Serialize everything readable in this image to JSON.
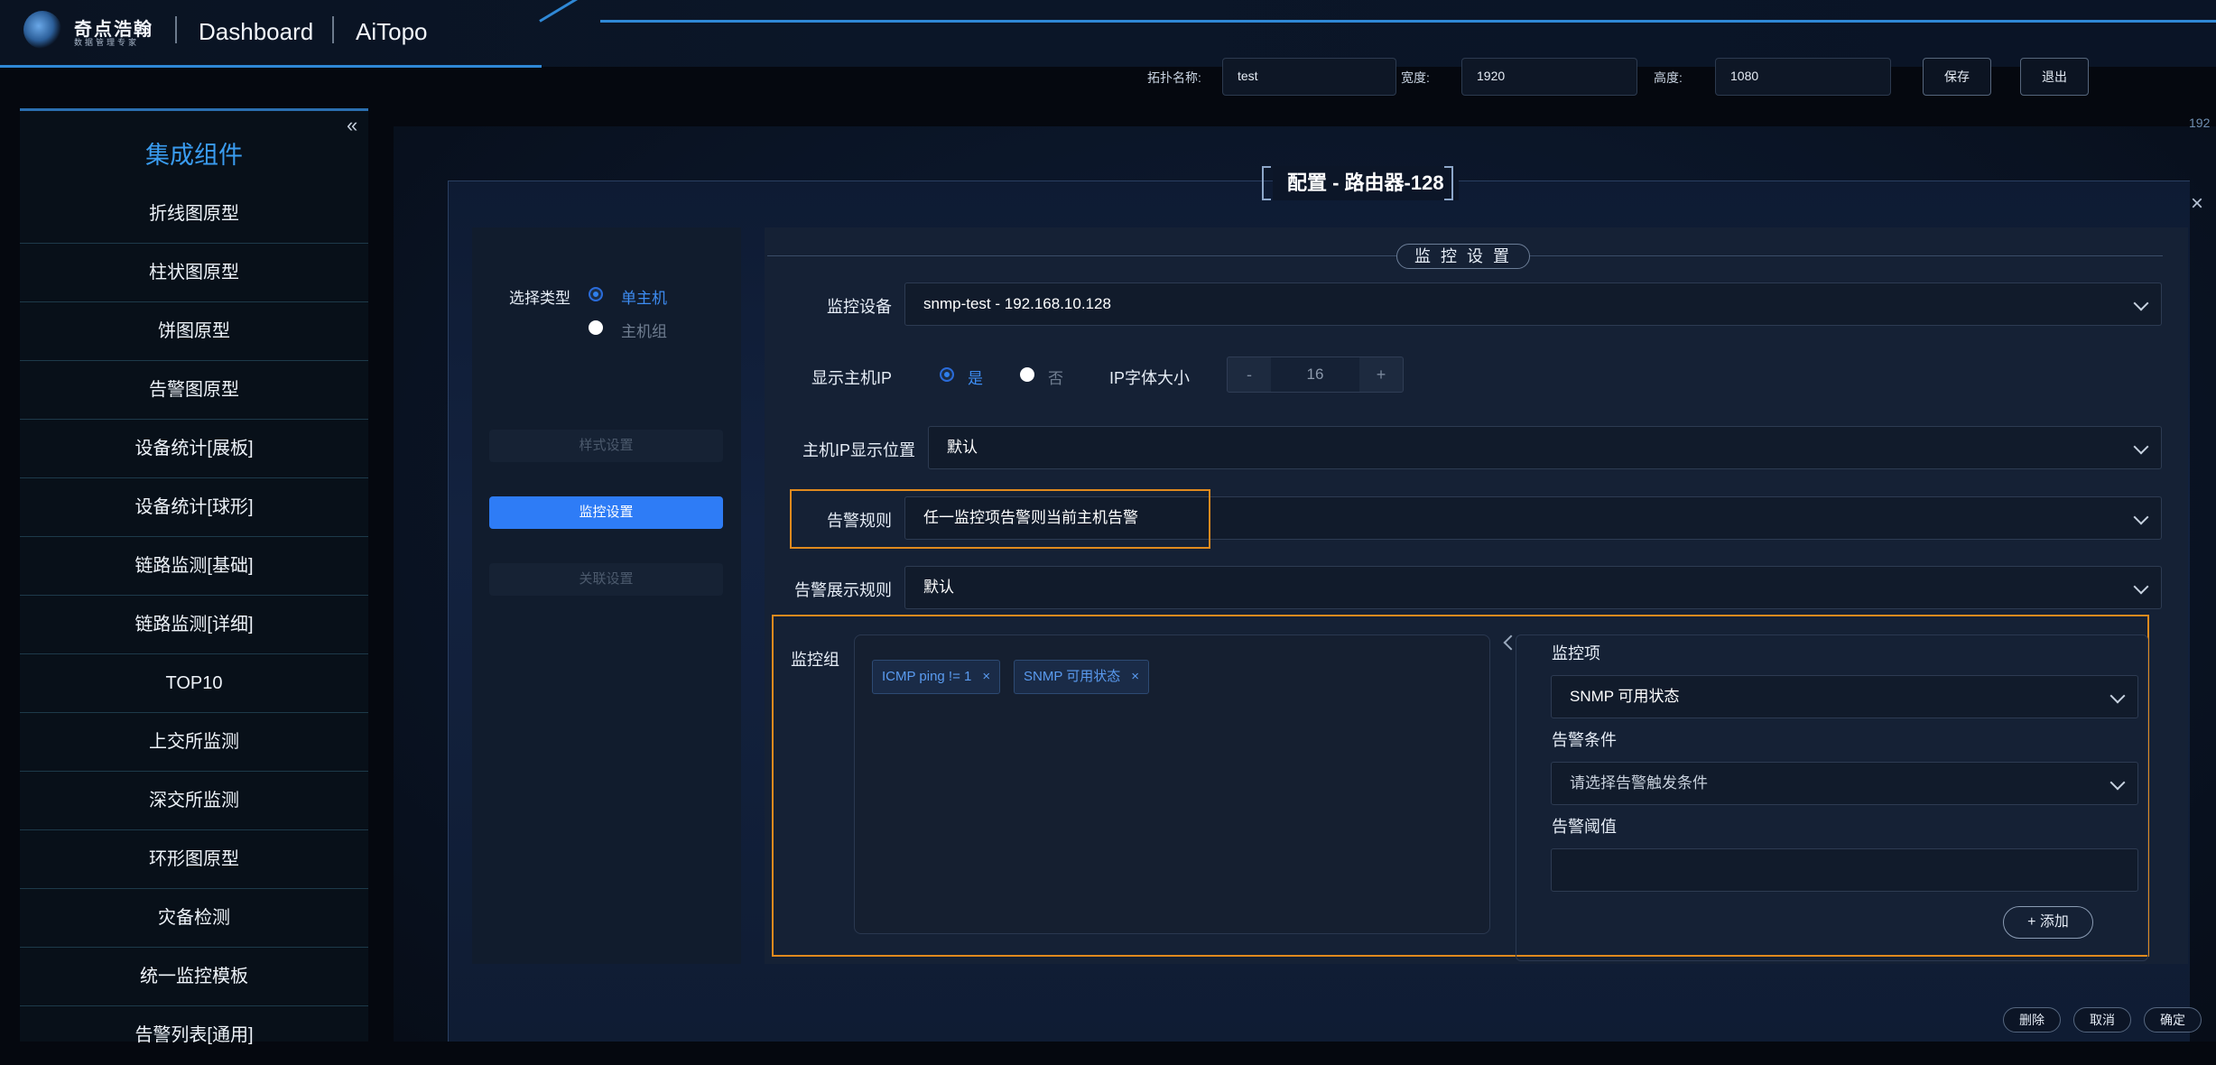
{
  "header": {
    "logo_text": "奇点浩翰",
    "logo_subtext": "数据管理专家",
    "nav": [
      "Dashboard",
      "AiTopo"
    ],
    "topo_name_label": "拓扑名称:",
    "topo_name_value": "test",
    "width_label": "宽度:",
    "width_value": "1920",
    "height_label": "高度:",
    "height_value": "1080",
    "save_label": "保存",
    "exit_label": "退出",
    "edge_number": "192"
  },
  "sidebar": {
    "title": "集成组件",
    "collapse_icon": "double-chevron-left",
    "items": [
      "折线图原型",
      "柱状图原型",
      "饼图原型",
      "告警图原型",
      "设备统计[展板]",
      "设备统计[球形]",
      "链路监测[基础]",
      "链路监测[详细]",
      "TOP10",
      "上交所监测",
      "深交所监测",
      "环形图原型",
      "灾备检测",
      "统一监控模板",
      "告警列表[通用]"
    ]
  },
  "modal": {
    "title": "配置 - 路由器-128",
    "left": {
      "select_type_label": "选择类型",
      "option_single": "单主机",
      "option_group": "主机组",
      "selected": "单主机",
      "btn_style": "样式设置",
      "btn_monitor": "监控设置",
      "btn_link": "关联设置"
    },
    "section_title": "监 控 设 置",
    "fields": {
      "device_label": "监控设备",
      "device_value": "snmp-test - 192.168.10.128",
      "show_ip_label": "显示主机IP",
      "show_ip_yes": "是",
      "show_ip_no": "否",
      "show_ip_selected": "是",
      "ip_font_label": "IP字体大小",
      "ip_font_value": "16",
      "step_minus": "-",
      "step_plus": "+",
      "ip_pos_label": "主机IP显示位置",
      "ip_pos_value": "默认",
      "alarm_rule_label": "告警规则",
      "alarm_rule_value": "任一监控项告警则当前主机告警",
      "alarm_display_label": "告警展示规则",
      "alarm_display_value": "默认",
      "group_label": "监控组"
    },
    "tags": [
      "ICMP ping != 1",
      "SNMP 可用状态"
    ],
    "tag_close": "×",
    "monitor_panel": {
      "item_label": "监控项",
      "item_value": "SNMP 可用状态",
      "condition_label": "告警条件",
      "condition_placeholder": "请选择告警触发条件",
      "threshold_label": "告警阈值",
      "threshold_value": "",
      "add_label": "添加",
      "add_icon": "+"
    },
    "footer": {
      "delete_label": "删除",
      "cancel_label": "取消",
      "confirm_label": "确定"
    },
    "close_icon": "×"
  },
  "colors": {
    "accent_blue": "#2e7cf6",
    "title_blue": "#3a9cf0",
    "highlight_orange": "#e08a1e"
  }
}
